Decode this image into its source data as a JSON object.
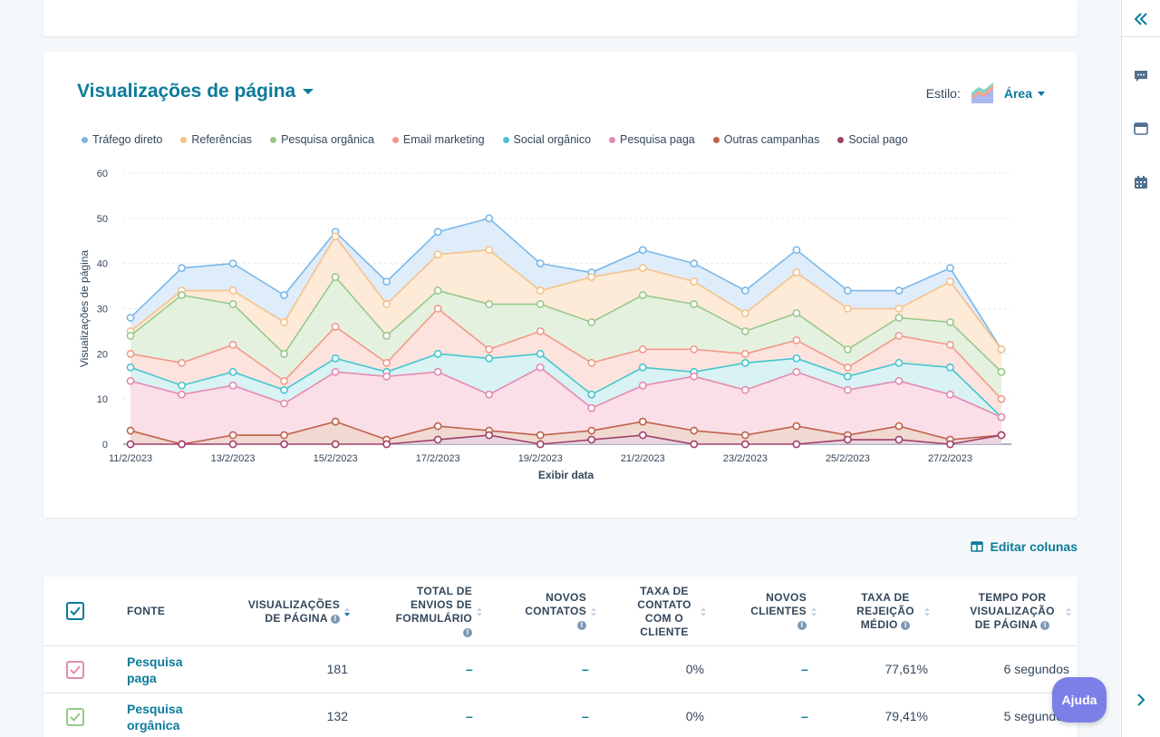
{
  "chart_card": {
    "title": "Visualizações de página",
    "style_label": "Estilo:",
    "style_value": "Área"
  },
  "chart_data": {
    "type": "area",
    "stacked": true,
    "xlabel": "Exibir data",
    "ylabel": "Visualizações de página",
    "ylim": [
      0,
      60
    ],
    "yticks": [
      0,
      10,
      20,
      30,
      40,
      50,
      60
    ],
    "x": [
      "11/2/2023",
      "12/2/2023",
      "13/2/2023",
      "14/2/2023",
      "15/2/2023",
      "16/2/2023",
      "17/2/2023",
      "18/2/2023",
      "19/2/2023",
      "20/2/2023",
      "21/2/2023",
      "22/2/2023",
      "23/2/2023",
      "24/2/2023",
      "25/2/2023",
      "26/2/2023",
      "27/2/2023",
      "28/2/2023"
    ],
    "xtick_labels": [
      "11/2/2023",
      "13/2/2023",
      "15/2/2023",
      "17/2/2023",
      "19/2/2023",
      "21/2/2023",
      "23/2/2023",
      "25/2/2023",
      "27/2/2023"
    ],
    "grid": true,
    "legend_position": "top-left",
    "series_cumulative": [
      {
        "name": "Tráfego direto",
        "color": "#7ab8ea",
        "fill": "#dbeafa",
        "values": [
          28,
          39,
          40,
          33,
          47,
          36,
          47,
          50,
          40,
          38,
          43,
          40,
          34,
          43,
          34,
          34,
          39,
          21
        ]
      },
      {
        "name": "Referências",
        "color": "#f5c28a",
        "fill": "#fde8d3",
        "values": [
          25,
          34,
          34,
          27,
          46,
          31,
          42,
          43,
          34,
          37,
          39,
          36,
          29,
          38,
          30,
          30,
          36,
          21
        ]
      },
      {
        "name": "Pesquisa orgânica",
        "color": "#98c98a",
        "fill": "#e2f0dc",
        "values": [
          24,
          33,
          31,
          20,
          37,
          24,
          34,
          31,
          31,
          27,
          33,
          31,
          25,
          29,
          21,
          28,
          27,
          16
        ]
      },
      {
        "name": "Email marketing",
        "color": "#f2998a",
        "fill": "#fde0da",
        "values": [
          20,
          18,
          22,
          14,
          26,
          18,
          30,
          21,
          25,
          18,
          21,
          21,
          20,
          23,
          17,
          24,
          22,
          10
        ]
      },
      {
        "name": "Social orgânico",
        "color": "#45c6cf",
        "fill": "#d5f1f3",
        "values": [
          17,
          13,
          16,
          12,
          19,
          16,
          20,
          19,
          20,
          11,
          17,
          16,
          18,
          19,
          15,
          18,
          17,
          6
        ]
      },
      {
        "name": "Pesquisa paga",
        "color": "#e58aaf",
        "fill": "#fadbe6",
        "values": [
          14,
          11,
          13,
          9,
          16,
          15,
          16,
          11,
          17,
          8,
          13,
          15,
          12,
          16,
          12,
          14,
          11,
          6
        ]
      },
      {
        "name": "Outras campanhas",
        "color": "#c0624a",
        "fill": "#f0d5cd",
        "values": [
          3,
          0,
          2,
          2,
          5,
          1,
          4,
          3,
          2,
          3,
          5,
          3,
          2,
          4,
          2,
          4,
          1,
          2
        ]
      },
      {
        "name": "Social pago",
        "color": "#a0406a",
        "fill": "#e8d0da",
        "values": [
          0,
          0,
          0,
          0,
          0,
          0,
          1,
          2,
          0,
          1,
          2,
          0,
          0,
          0,
          1,
          1,
          0,
          2
        ]
      }
    ]
  },
  "table": {
    "edit_columns": "Editar colunas",
    "headers": {
      "source": "Fonte",
      "pageviews": "Visualizações de página",
      "form_submissions": "Total de envios de formulário",
      "new_contacts": "Novos contatos",
      "contact_rate": "Taxa de contato com o cliente",
      "new_customers": "Novos clientes",
      "bounce_rate": "Taxa de rejeição médio",
      "time_per_view": "Tempo por visualização de página"
    },
    "rows": [
      {
        "source": "Pesquisa paga",
        "pageviews": "181",
        "form_submissions": "–",
        "new_contacts": "–",
        "contact_rate": "0%",
        "new_customers": "–",
        "bounce_rate": "77,61%",
        "time_per_view": "6 segundos",
        "color": "#e58aaf"
      },
      {
        "source": "Pesquisa orgânica",
        "pageviews": "132",
        "form_submissions": "–",
        "new_contacts": "–",
        "contact_rate": "0%",
        "new_customers": "–",
        "bounce_rate": "79,41%",
        "time_per_view": "5 segundos",
        "color": "#98c98a"
      }
    ]
  },
  "help_button": "Ajuda"
}
